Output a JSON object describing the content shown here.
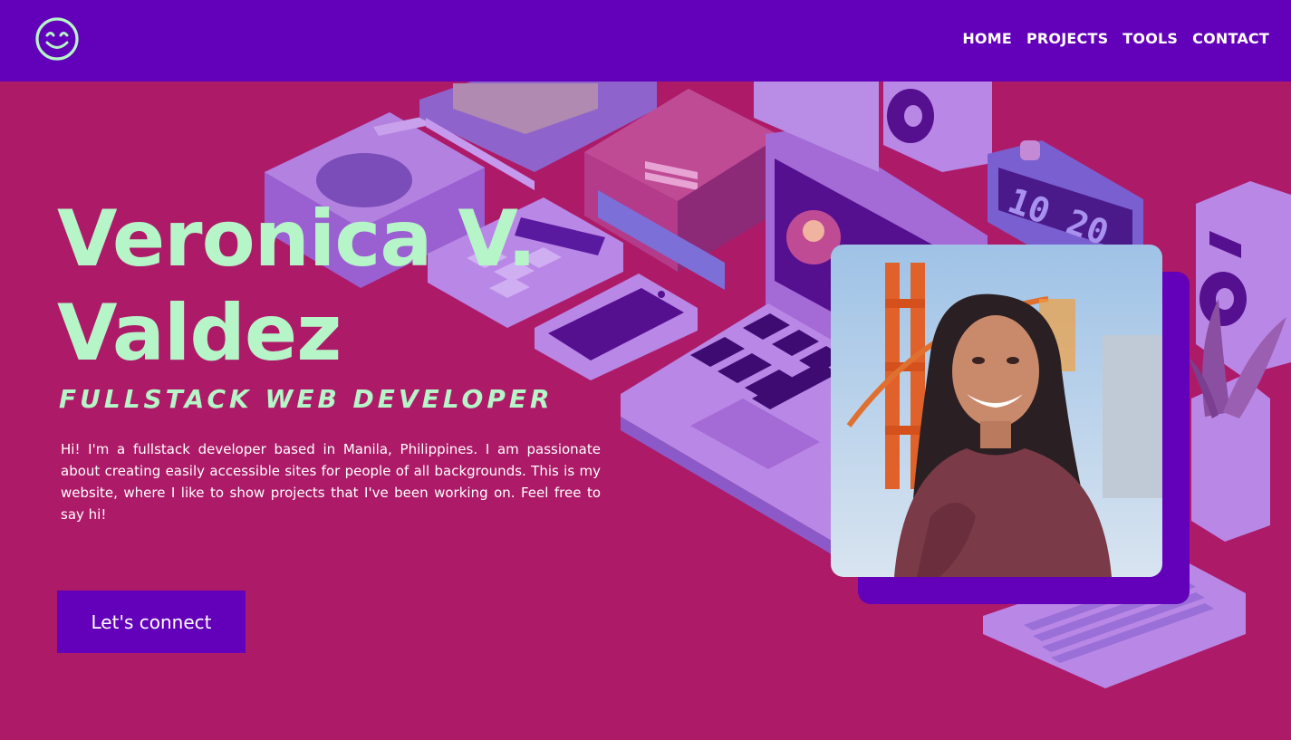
{
  "nav": {
    "logo": "smiley-face-logo",
    "links": [
      "HOME",
      "PROJECTS",
      "TOOLS",
      "CONTACT"
    ]
  },
  "hero": {
    "name_line1": "Veronica V.",
    "name_line2": "Valdez",
    "role": "FULLSTACK WEB DEVELOPER",
    "intro": "Hi! I'm a fullstack developer based in Manila, Philippines. I am passionate about creating easily accessible sites for people of all backgrounds. This is my website, where I like to show projects that I've been working on. Feel free to say hi!",
    "cta_label": "Let's connect"
  },
  "background": {
    "clock_text": "10 20"
  },
  "colors": {
    "navbar": "#6300b9",
    "page_background": "#ad1a68",
    "heading_accent": "#b5f5c8",
    "button": "#6300b9",
    "illustration_purple": "#a46ad6"
  },
  "photo": {
    "alt": "profile-photo"
  }
}
